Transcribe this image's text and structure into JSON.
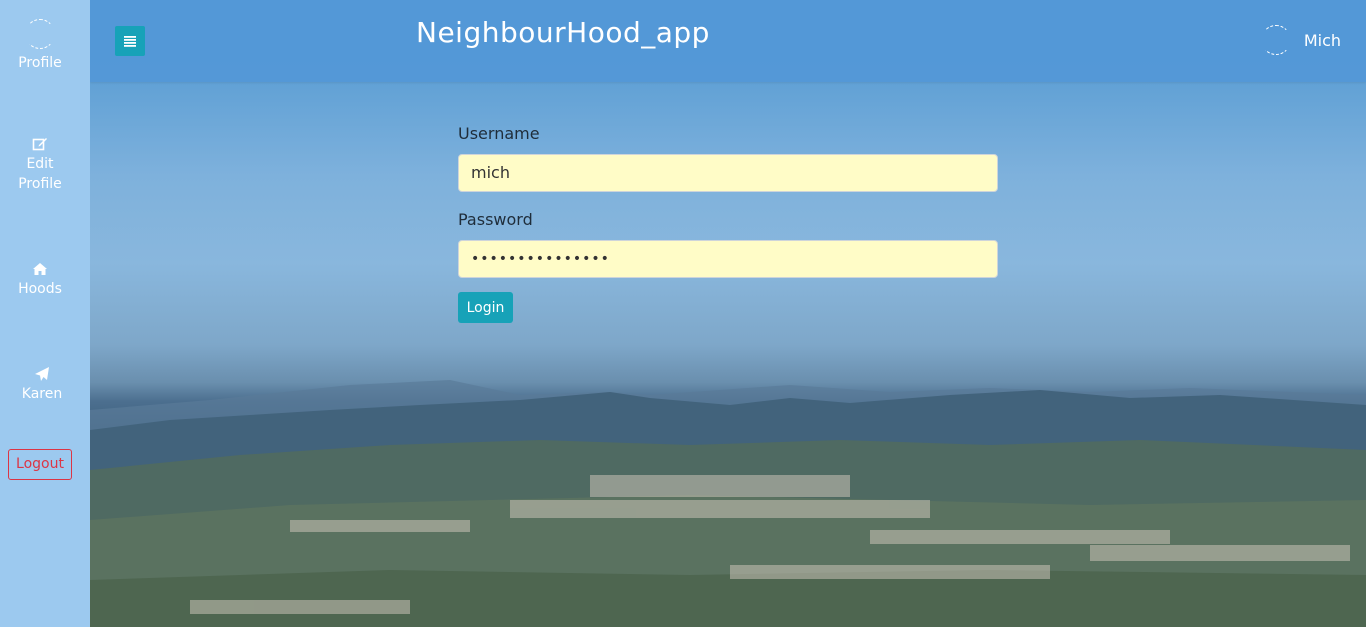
{
  "app": {
    "title": "NeighbourHood_app"
  },
  "sidebar": {
    "items": [
      {
        "label": "Profile",
        "icon": "avatar-icon"
      },
      {
        "label": "Edit Profile",
        "icon": "edit-icon"
      },
      {
        "label": "Hoods",
        "icon": "home-icon"
      },
      {
        "label": "Karen",
        "icon": "paper-plane-icon"
      }
    ],
    "logout_label": "Logout"
  },
  "header": {
    "menu_icon": "menu-list-icon",
    "user_name": "Mich"
  },
  "login_form": {
    "username_label": "Username",
    "username_value": "mich",
    "password_label": "Password",
    "password_value": "•••••••••••••••",
    "submit_label": "Login"
  },
  "colors": {
    "sidebar_bg": "#9cc9ef",
    "accent": "#17a2b8",
    "danger": "#dc3545",
    "input_autofill_bg": "#fffcc7"
  }
}
